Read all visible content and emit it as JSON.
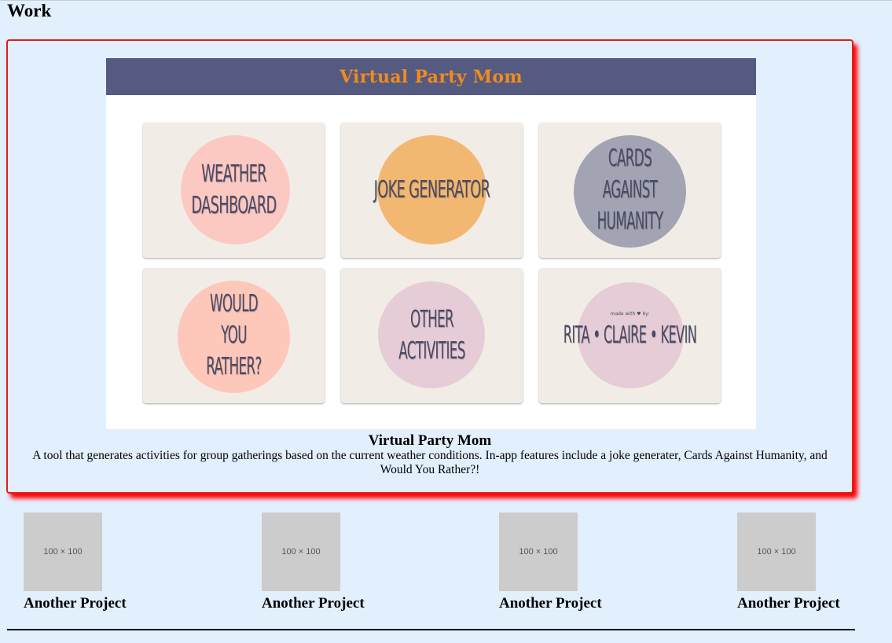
{
  "section": {
    "title": "Work"
  },
  "featured": {
    "header_title": "Virtual Party Mom",
    "tiles": [
      {
        "label": "WEATHER DASHBOARD",
        "circle_color": "#fcc9c2"
      },
      {
        "label": "JOKE GENERATOR",
        "circle_color": "#f2b872"
      },
      {
        "label": "CARDS AGAINST HUMANITY",
        "circle_color": "#a2a4b4"
      },
      {
        "label": "WOULD YOU RATHER?",
        "circle_color": "#fdc7b9"
      },
      {
        "label": "OTHER ACTIVITIES",
        "circle_color": "#e6ccd6"
      },
      {
        "label": "RITA • CLAIRE • KEVIN",
        "sublabel": "made with ♥ by:",
        "circle_color": "#e6ccd6"
      }
    ],
    "caption_title": "Virtual Party Mom",
    "caption_desc": "A tool that generates activities for group gatherings based on the current weather conditions. In-app features include a joke generater, Cards Against Humanity, and Would You Rather?!"
  },
  "projects": [
    {
      "thumb": "100 × 100",
      "title": "Another Project"
    },
    {
      "thumb": "100 × 100",
      "title": "Another Project"
    },
    {
      "thumb": "100 × 100",
      "title": "Another Project"
    },
    {
      "thumb": "100 × 100",
      "title": "Another Project"
    }
  ],
  "colors": {
    "page_background": "#e2effd",
    "featured_border": "#e41b1b",
    "header_bar": "#545a80",
    "header_text": "#f28a1c",
    "tile_background": "#f1ede6",
    "placeholder": "#cccccc"
  }
}
